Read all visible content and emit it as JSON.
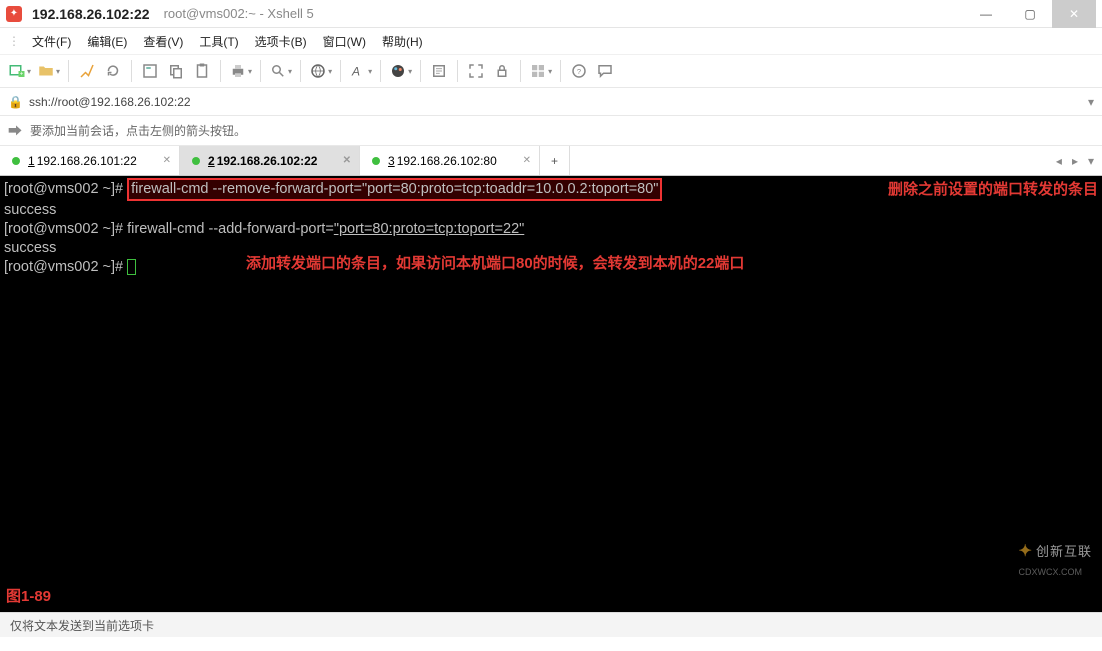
{
  "titlebar": {
    "main": "192.168.26.102:22",
    "sub": "root@vms002:~ - Xshell 5"
  },
  "menu": {
    "file": "文件(F)",
    "edit": "编辑(E)",
    "view": "查看(V)",
    "tools": "工具(T)",
    "tabs": "选项卡(B)",
    "window": "窗口(W)",
    "help": "帮助(H)"
  },
  "addressbar": {
    "url": "ssh://root@192.168.26.102:22"
  },
  "infobar": {
    "hint": "要添加当前会话，点击左侧的箭头按钮。"
  },
  "tabs": [
    {
      "prefix": "1",
      "label": "192.168.26.101:22",
      "active": false
    },
    {
      "prefix": "2",
      "label": "192.168.26.102:22",
      "active": true
    },
    {
      "prefix": "3",
      "label": "192.168.26.102:80",
      "active": false
    }
  ],
  "terminal": {
    "line1_prompt": "[root@vms002 ~]# ",
    "line1_cmd": "firewall-cmd --remove-forward-port=\"port=80:proto=tcp:toaddr=10.0.0.2:toport=80\"",
    "line2": "success",
    "line3_prompt": "[root@vms002 ~]# ",
    "line3_cmd_a": "firewall-cmd --add-forward-port=",
    "line3_cmd_b": "\"port=80:proto=tcp:toport=22\"",
    "line4": "success",
    "line5_prompt": "[root@vms002 ~]# ",
    "anno_right": "删除之前设置的端口转发的条目",
    "anno_mid": "添加转发端口的条目，如果访问本机端口80的时候，会转发到本机的22端口",
    "fig_label": "图1-89"
  },
  "statusbar": {
    "text": "仅将文本发送到当前选项卡"
  },
  "watermark": {
    "brand": "创新互联",
    "sub": "CDXWCX.COM"
  }
}
